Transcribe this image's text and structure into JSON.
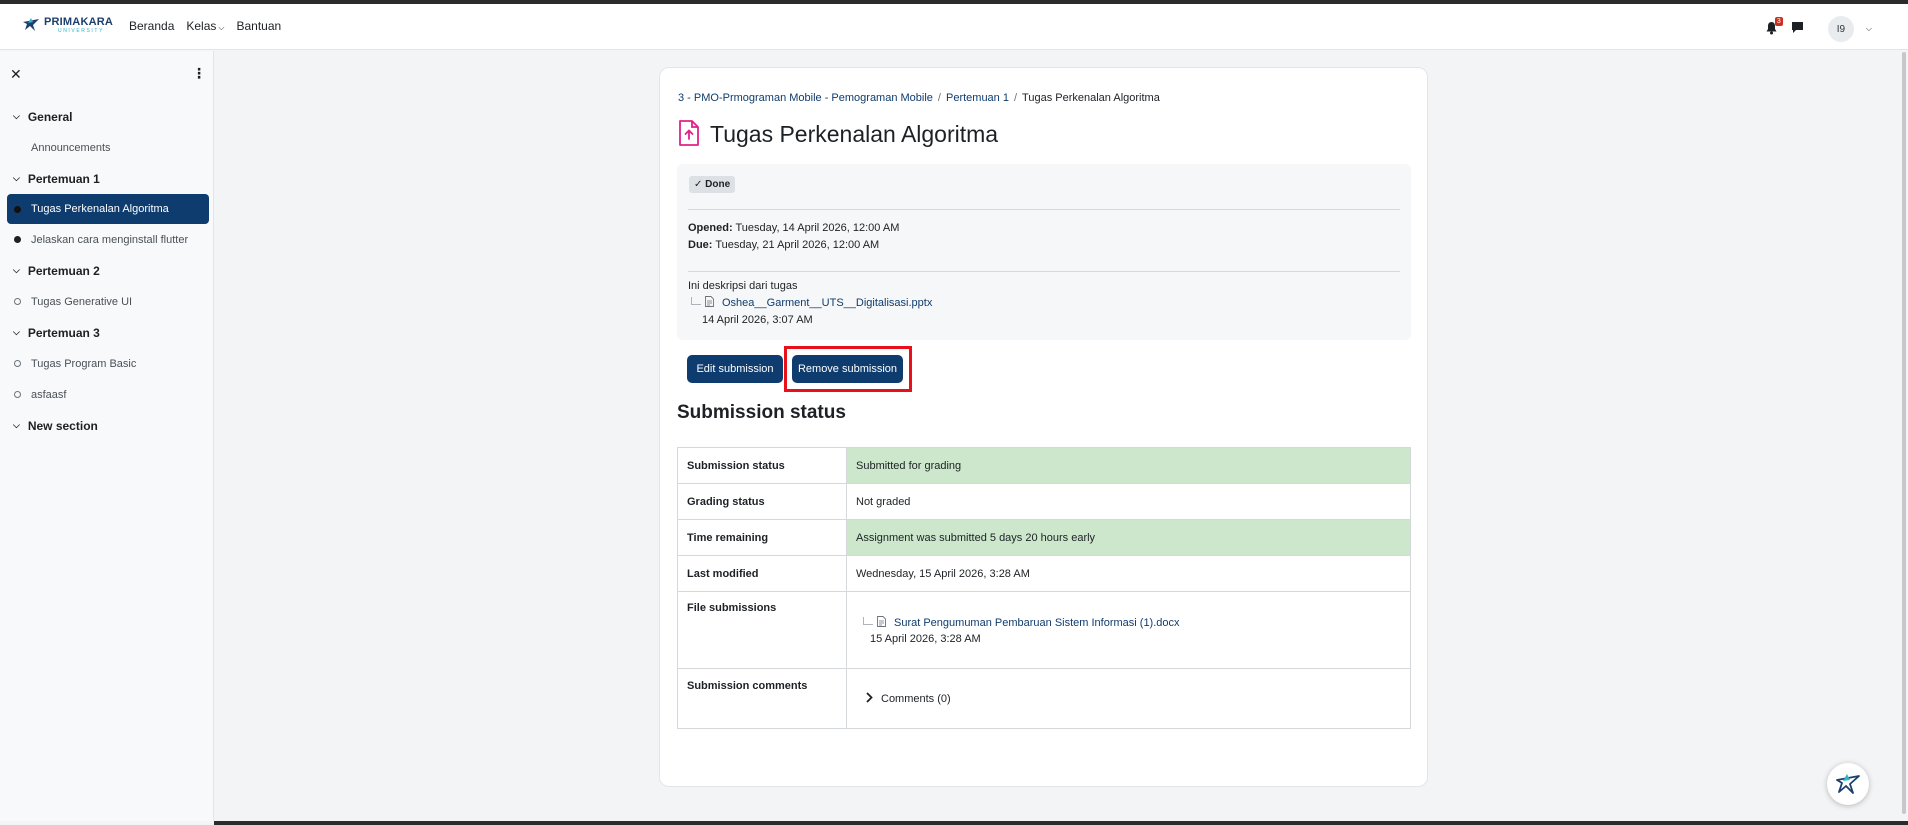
{
  "navbar": {
    "logo_main": "PRIMAKARA",
    "logo_sub": "UNIVERSITY",
    "links": [
      "Beranda",
      "Kelas",
      "Bantuan"
    ],
    "notification_count": "3",
    "avatar_initials": "I9"
  },
  "drawer": {
    "sections": [
      {
        "label": "General",
        "items": [
          {
            "label": "Announcements",
            "marker": "none",
            "active": false
          }
        ]
      },
      {
        "label": "Pertemuan 1",
        "items": [
          {
            "label": "Tugas Perkenalan Algoritma",
            "marker": "filled",
            "active": true
          },
          {
            "label": "Jelaskan cara menginstall flutter",
            "marker": "filled",
            "active": false
          }
        ]
      },
      {
        "label": "Pertemuan 2",
        "items": [
          {
            "label": "Tugas Generative UI",
            "marker": "open",
            "active": false
          }
        ]
      },
      {
        "label": "Pertemuan 3",
        "items": [
          {
            "label": "Tugas Program Basic",
            "marker": "open",
            "active": false
          },
          {
            "label": "asfaasf",
            "marker": "open",
            "active": false
          }
        ]
      },
      {
        "label": "New section",
        "items": []
      }
    ]
  },
  "breadcrumb": {
    "course": "3 - PMO-Prmograman Mobile - Pemograman Mobile",
    "section": "Pertemuan 1",
    "current": "Tugas Perkenalan Algoritma"
  },
  "page": {
    "title": "Tugas Perkenalan Algoritma",
    "done_label": "Done",
    "opened_label": "Opened:",
    "opened_value": "Tuesday, 14 April 2026, 12:00 AM",
    "due_label": "Due:",
    "due_value": "Tuesday, 21 April 2026, 12:00 AM",
    "description": "Ini deskripsi dari tugas",
    "attachment_name": "Oshea__Garment__UTS__Digitalisasi.pptx",
    "attachment_date": "14 April 2026, 3:07 AM",
    "edit_button": "Edit submission",
    "remove_button": "Remove submission"
  },
  "submission": {
    "heading": "Submission status",
    "rows": {
      "status": {
        "label": "Submission status",
        "value": "Submitted for grading"
      },
      "grading": {
        "label": "Grading status",
        "value": "Not graded"
      },
      "time": {
        "label": "Time remaining",
        "value": "Assignment was submitted 5 days 20 hours early"
      },
      "modified": {
        "label": "Last modified",
        "value": "Wednesday, 15 April 2026, 3:28 AM"
      },
      "files": {
        "label": "File submissions",
        "file_name": "Surat Pengumuman Pembaruan Sistem Informasi (1).docx",
        "file_date": "15 April 2026, 3:28 AM"
      },
      "comments": {
        "label": "Submission comments",
        "value": "Comments (0)"
      }
    }
  },
  "colors": {
    "brand": "#0f3c6e",
    "success_row": "#cce7cc",
    "highlight": "#e8111a",
    "icon_pink": "#e2208a"
  }
}
